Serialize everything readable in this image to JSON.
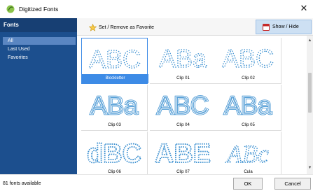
{
  "window": {
    "title": "Digitized Fonts"
  },
  "sidebar": {
    "header": "Fonts",
    "items": [
      {
        "label": "All",
        "selected": true
      },
      {
        "label": "Last Used",
        "selected": false
      },
      {
        "label": "Favorites",
        "selected": false
      }
    ]
  },
  "toolbar": {
    "favorite_label": "Set / Remove as Favorite",
    "show_hide_label": "Show / Hide"
  },
  "fonts": [
    {
      "name": "Blockletter",
      "preview": "ABC",
      "style": "dotted-outline",
      "selected": true
    },
    {
      "name": "Clip 01",
      "preview": "ABa",
      "style": "dotted-outline",
      "selected": false
    },
    {
      "name": "Clip 02",
      "preview": "ABC",
      "style": "dotted-outline",
      "selected": false
    },
    {
      "name": "Clip 03",
      "preview": "ABa",
      "style": "double-line",
      "selected": false
    },
    {
      "name": "Clip 04",
      "preview": "ABC",
      "style": "double-line",
      "selected": false
    },
    {
      "name": "Clip 05",
      "preview": "ABa",
      "style": "double-line",
      "selected": false
    },
    {
      "name": "Clip 06",
      "preview": "dBC",
      "style": "dotted-block",
      "selected": false
    },
    {
      "name": "Clip 07",
      "preview": "ABE",
      "style": "dotted-block",
      "selected": false
    },
    {
      "name": "Cula",
      "preview": "ABc",
      "style": "dotted-script",
      "selected": false
    }
  ],
  "status": {
    "count_text": "81 fonts available"
  },
  "buttons": {
    "ok": "OK",
    "cancel": "Cancel"
  },
  "colors": {
    "sidebar_bg": "#1c4f8e",
    "preview_stroke": "#3a8fd0",
    "selection": "#3d8be6"
  }
}
